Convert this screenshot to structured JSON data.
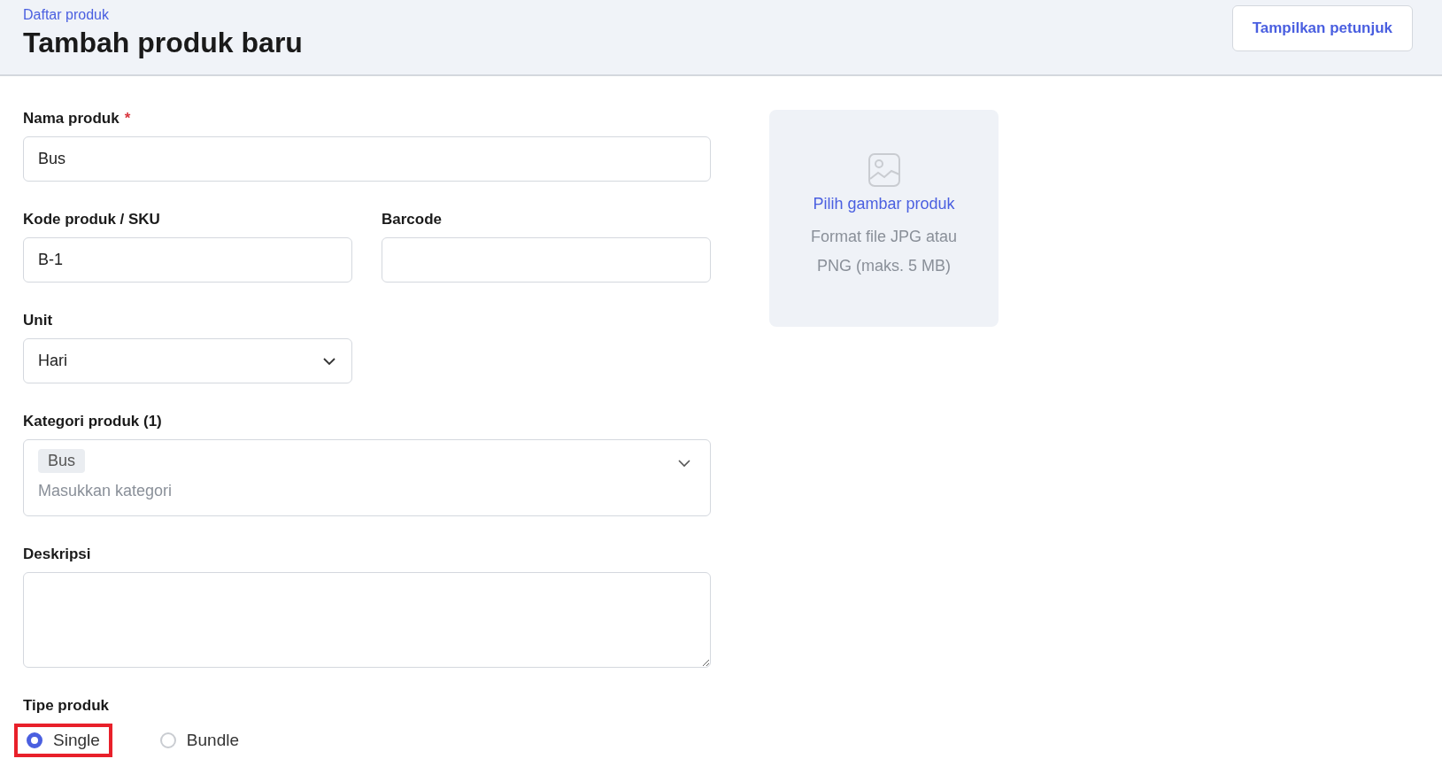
{
  "header": {
    "breadcrumb": "Daftar produk",
    "title": "Tambah produk baru",
    "help_button": "Tampilkan petunjuk"
  },
  "form": {
    "name": {
      "label": "Nama produk",
      "required_mark": "*",
      "value": "Bus"
    },
    "sku": {
      "label": "Kode produk / SKU",
      "value": "B-1"
    },
    "barcode": {
      "label": "Barcode"
    },
    "unit": {
      "label": "Unit",
      "value": "Hari"
    },
    "category": {
      "label": "Kategori produk (1)",
      "tags": [
        "Bus"
      ],
      "placeholder": "Masukkan kategori"
    },
    "description": {
      "label": "Deskripsi"
    },
    "type": {
      "label": "Tipe produk",
      "options": [
        {
          "label": "Single",
          "selected": true,
          "highlighted": true
        },
        {
          "label": "Bundle",
          "selected": false,
          "highlighted": false
        }
      ]
    }
  },
  "image_upload": {
    "link": "Pilih gambar produk",
    "hint": "Format file JPG atau PNG (maks. 5 MB)"
  }
}
